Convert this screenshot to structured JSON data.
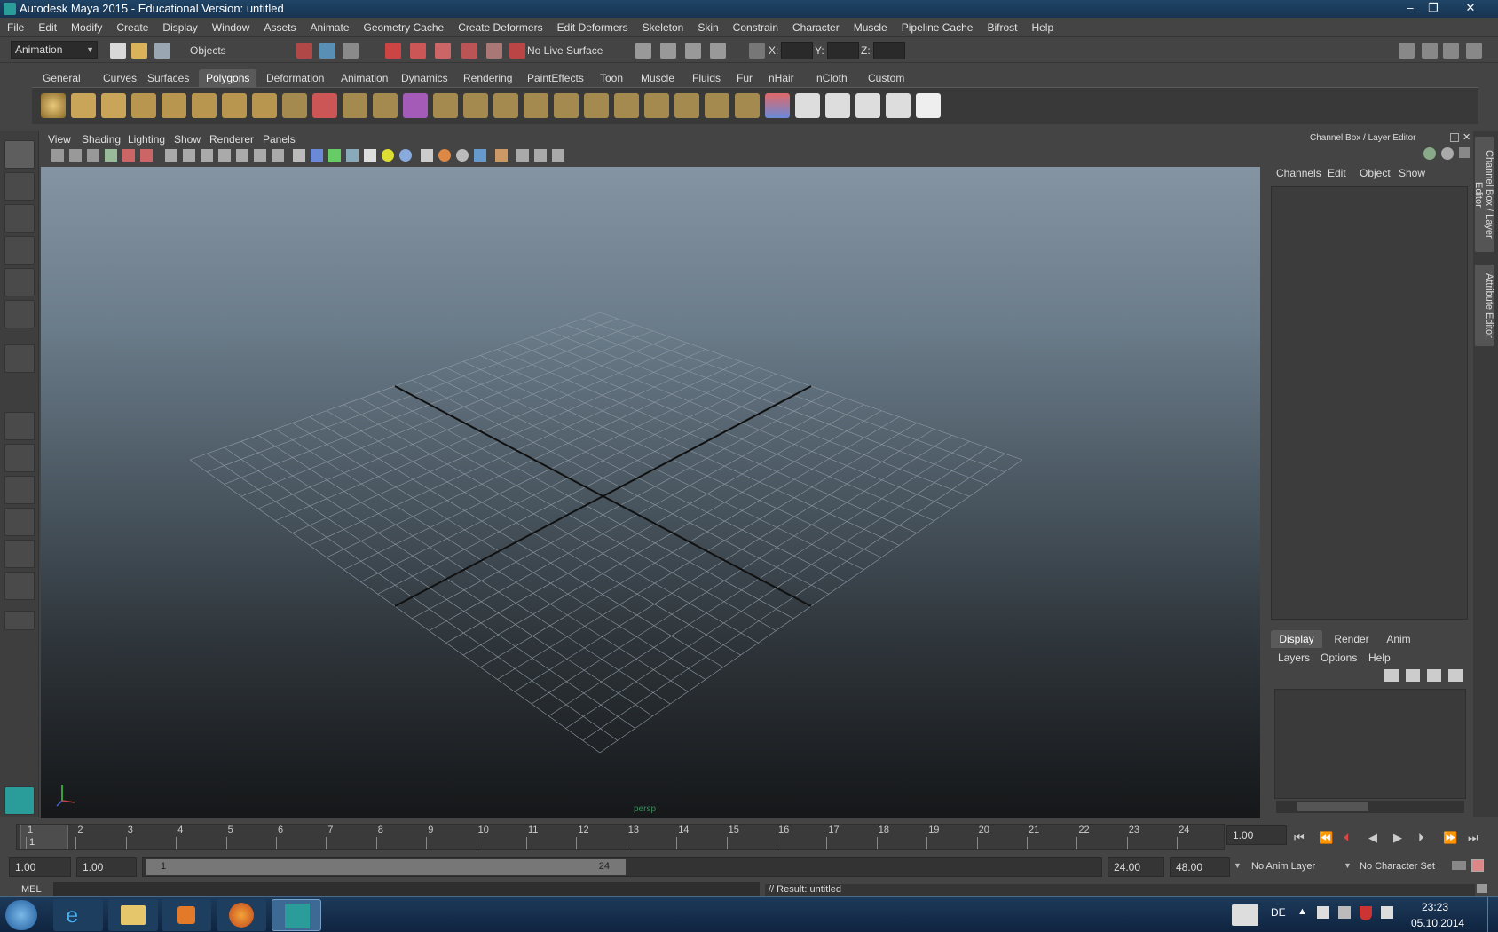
{
  "window": {
    "title": "Autodesk Maya 2015 - Educational Version: untitled",
    "minimize": "–",
    "maximize": "❐",
    "close": "✕"
  },
  "menubar": [
    "File",
    "Edit",
    "Modify",
    "Create",
    "Display",
    "Window",
    "Assets",
    "Animate",
    "Geometry Cache",
    "Create Deformers",
    "Edit Deformers",
    "Skeleton",
    "Skin",
    "Constrain",
    "Character",
    "Muscle",
    "Pipeline Cache",
    "Bifrost",
    "Help"
  ],
  "statusline": {
    "menuset": "Animation",
    "selection_mode": "Objects",
    "live_surface": "No Live Surface",
    "x_label": "X:",
    "y_label": "Y:",
    "z_label": "Z:"
  },
  "shelf_tabs": [
    {
      "label": "General",
      "active": false
    },
    {
      "label": "Curves",
      "active": false
    },
    {
      "label": "Surfaces",
      "active": false
    },
    {
      "label": "Polygons",
      "active": true
    },
    {
      "label": "Deformation",
      "active": false
    },
    {
      "label": "Animation",
      "active": false
    },
    {
      "label": "Dynamics",
      "active": false
    },
    {
      "label": "Rendering",
      "active": false
    },
    {
      "label": "PaintEffects",
      "active": false
    },
    {
      "label": "Toon",
      "active": false
    },
    {
      "label": "Muscle",
      "active": false
    },
    {
      "label": "Fluids",
      "active": false
    },
    {
      "label": "Fur",
      "active": false
    },
    {
      "label": "nHair",
      "active": false
    },
    {
      "label": "nCloth",
      "active": false
    },
    {
      "label": "Custom",
      "active": false
    }
  ],
  "viewport": {
    "menus": [
      "View",
      "Shading",
      "Lighting",
      "Show",
      "Renderer",
      "Panels"
    ],
    "camera_label": "persp"
  },
  "channel_box": {
    "title": "Channel Box / Layer Editor",
    "menus": [
      "Channels",
      "Edit",
      "Object",
      "Show"
    ]
  },
  "layer_editor": {
    "tabs": [
      {
        "label": "Display",
        "active": true
      },
      {
        "label": "Render",
        "active": false
      },
      {
        "label": "Anim",
        "active": false
      }
    ],
    "menus": [
      "Layers",
      "Options",
      "Help"
    ]
  },
  "side_tabs": [
    "Channel Box / Layer Editor",
    "Attribute Editor"
  ],
  "timeline": {
    "numbers": [
      "1",
      "2",
      "3",
      "4",
      "5",
      "6",
      "7",
      "8",
      "9",
      "10",
      "11",
      "12",
      "13",
      "14",
      "15",
      "16",
      "17",
      "18",
      "19",
      "20",
      "21",
      "22",
      "23",
      "24"
    ],
    "current_frame": "1",
    "current_time_field": "1.00"
  },
  "range": {
    "start_time": "1.00",
    "playback_start": "1.00",
    "range_start_label": "1",
    "range_end_label": "24",
    "playback_end": "24.00",
    "end_time": "48.00",
    "anim_layer": "No Anim Layer",
    "character_set": "No Character Set"
  },
  "command_line": {
    "mode": "MEL",
    "result": "// Result: untitled"
  },
  "taskbar": {
    "language": "DE",
    "time": "23:23",
    "date": "05.10.2014"
  }
}
